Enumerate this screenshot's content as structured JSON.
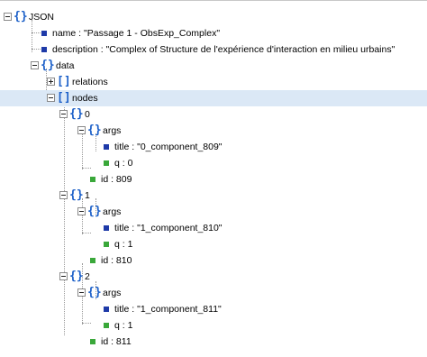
{
  "tree": {
    "root": {
      "label": "JSON",
      "icon": "object-braces-icon"
    },
    "name_row": "name : \"Passage 1 - ObsExp_Complex\"",
    "description_row": "description : \"Complex of Structure de l'expérience d'interaction en milieu urbains\"",
    "data": {
      "label": "data",
      "icon": "object-braces-icon"
    },
    "relations": {
      "label": "relations",
      "icon": "array-brackets-icon"
    },
    "nodes": {
      "label": "nodes",
      "icon": "array-brackets-icon",
      "selected": true
    },
    "items": [
      {
        "label": "0",
        "args_label": "args",
        "title_row": "title : \"0_component_809\"",
        "q_row": "q : 0",
        "id_row": "id : 809"
      },
      {
        "label": "1",
        "args_label": "args",
        "title_row": "title : \"1_component_810\"",
        "q_row": "q : 1",
        "id_row": "id : 810"
      },
      {
        "label": "2",
        "args_label": "args",
        "title_row": "title : \"1_component_811\"",
        "q_row": "q : 1",
        "id_row": "id : 811"
      }
    ],
    "colors": {
      "string_value": "#1e3aa8",
      "number_value": "#3aa83a",
      "bracket": "#1b5fc8",
      "selection": "#dbe8f6"
    }
  }
}
